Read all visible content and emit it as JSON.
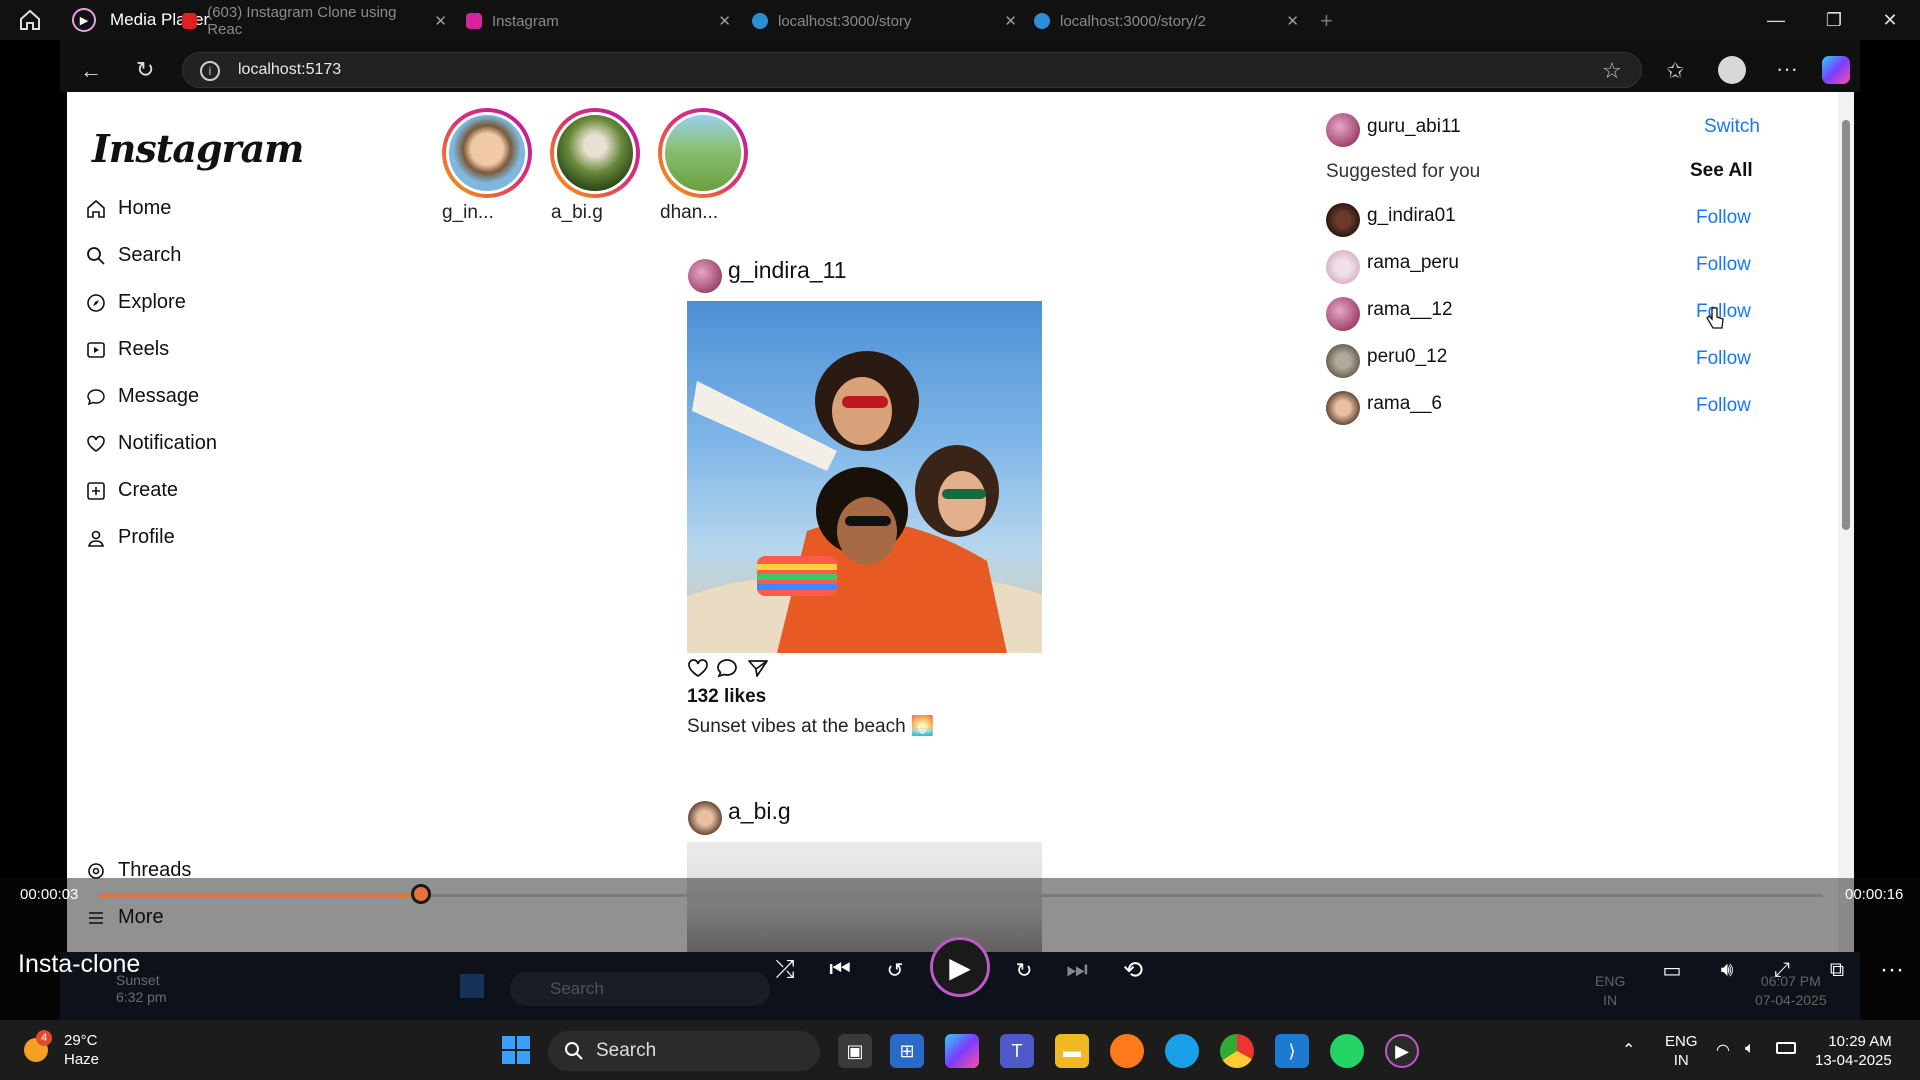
{
  "player": {
    "app_title": "Media Player",
    "video_title": "Insta-clone",
    "time_elapsed": "00:00:03",
    "time_total": "00:00:16",
    "progress_fraction": 0.1875
  },
  "browser_tabs": [
    {
      "label": "(603) Instagram Clone using Reac",
      "icon_color": "#e02020"
    },
    {
      "label": "Instagram",
      "icon_color": "#d6249f"
    },
    {
      "label": "localhost:3000/story",
      "icon_color": "#2a8fd6"
    },
    {
      "label": "localhost:3000/story/2",
      "icon_color": "#2a8fd6"
    }
  ],
  "address_bar": {
    "url": "localhost:5173"
  },
  "instagram": {
    "logo": "Instagram",
    "nav": [
      {
        "label": "Home",
        "icon": "home-icon"
      },
      {
        "label": "Search",
        "icon": "search-icon"
      },
      {
        "label": "Explore",
        "icon": "compass-icon"
      },
      {
        "label": "Reels",
        "icon": "reels-icon"
      },
      {
        "label": "Message",
        "icon": "message-icon"
      },
      {
        "label": "Notification",
        "icon": "heart-icon"
      },
      {
        "label": "Create",
        "icon": "plus-square-icon"
      },
      {
        "label": "Profile",
        "icon": "user-icon"
      },
      {
        "label": "Threads",
        "icon": "threads-icon"
      },
      {
        "label": "More",
        "icon": "menu-icon"
      }
    ],
    "stories": [
      {
        "label": "g_in..."
      },
      {
        "label": "a_bi.g"
      },
      {
        "label": "dhan..."
      }
    ],
    "posts": [
      {
        "user": "g_indira_11",
        "likes": "132 likes",
        "caption": "Sunset vibes at the beach 🌅"
      },
      {
        "user": "a_bi.g"
      }
    ],
    "current_user": {
      "name": "guru_abi11",
      "switch_label": "Switch"
    },
    "suggested": {
      "heading": "Suggested for you",
      "see_all": "See All",
      "follow_label": "Follow",
      "users": [
        "g_indira01",
        "rama_peru",
        "rama__12",
        "peru0_12",
        "rama__6"
      ]
    }
  },
  "ghost_taskbar": {
    "search": "Search",
    "lang": "ENG",
    "region": "IN",
    "time": "06:07 PM",
    "date": "07-04-2025",
    "weather_label": "Sunset",
    "weather_time": "6:32 pm"
  },
  "taskbar": {
    "weather_temp": "29°C",
    "weather_desc": "Haze",
    "weather_badge": "4",
    "search": "Search",
    "lang": "ENG",
    "region": "IN",
    "time": "10:29 AM",
    "date": "13-04-2025"
  }
}
